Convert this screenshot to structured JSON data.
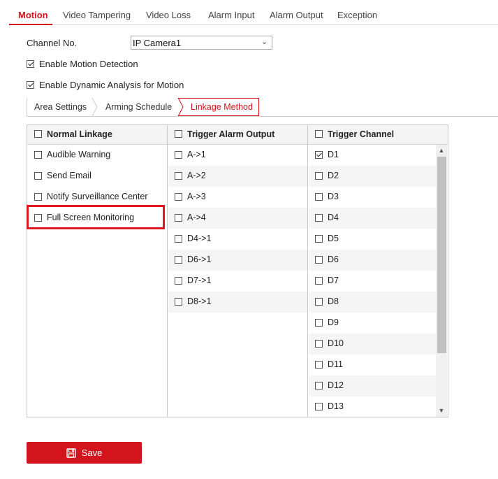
{
  "top_tabs": [
    "Motion",
    "Video Tampering",
    "Video Loss",
    "Alarm Input",
    "Alarm Output",
    "Exception"
  ],
  "channel": {
    "label": "Channel No.",
    "value": "IP Camera1"
  },
  "options": {
    "enable_motion": {
      "label": "Enable Motion Detection",
      "checked": true
    },
    "enable_dynamic": {
      "label": "Enable Dynamic Analysis for Motion",
      "checked": true
    }
  },
  "sub_tabs": [
    "Area Settings",
    "Arming Schedule",
    "Linkage Method"
  ],
  "normal_linkage": {
    "header": "Normal Linkage",
    "items": [
      "Audible Warning",
      "Send Email",
      "Notify Surveillance Center",
      "Full Screen Monitoring"
    ]
  },
  "trigger_alarm": {
    "header": "Trigger Alarm Output",
    "items": [
      "A->1",
      "A->2",
      "A->3",
      "A->4",
      "D4->1",
      "D6->1",
      "D7->1",
      "D8->1"
    ]
  },
  "trigger_channel": {
    "header": "Trigger Channel",
    "items": [
      "D1",
      "D2",
      "D3",
      "D4",
      "D5",
      "D6",
      "D7",
      "D8",
      "D9",
      "D10",
      "D11",
      "D12",
      "D13"
    ],
    "checked": [
      "D1"
    ]
  },
  "save_label": "Save",
  "colors": {
    "accent": "#d3141c",
    "highlight": "#e0191f"
  }
}
